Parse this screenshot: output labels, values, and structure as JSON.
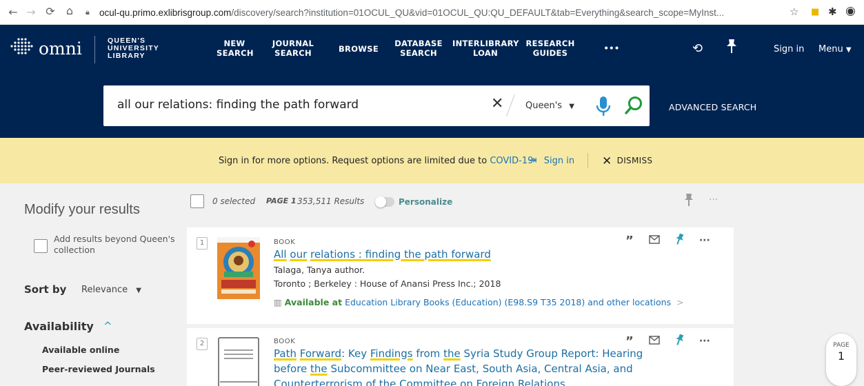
{
  "browser": {
    "url_host": "ocul-qu.primo.exlibrisgroup.com",
    "url_rest": "/discovery/search?institution=01OCUL_QU&vid=01OCUL_QU:QU_DEFAULT&tab=Everything&search_scope=MyInst..."
  },
  "header": {
    "logo_word": "omni",
    "logo_line1": "QUEEN'S",
    "logo_line2": "UNIVERSITY",
    "logo_line3": "LIBRARY",
    "nav": [
      {
        "l1": "NEW",
        "l2": "SEARCH"
      },
      {
        "l1": "JOURNAL",
        "l2": "SEARCH"
      },
      {
        "l1": "BROWSE",
        "l2": ""
      },
      {
        "l1": "DATABASE",
        "l2": "SEARCH"
      },
      {
        "l1": "INTERLIBRARY",
        "l2": "LOAN"
      },
      {
        "l1": "RESEARCH",
        "l2": "GUIDES"
      },
      {
        "l1": "•••",
        "l2": ""
      }
    ],
    "sign_in": "Sign in",
    "menu": "Menu"
  },
  "search": {
    "query": "all our relations: finding the path forward",
    "scope": "Queen's",
    "advanced": "ADVANCED SEARCH"
  },
  "banner": {
    "text": "Sign in for more options. Request options are limited due to",
    "link": "COVID-19",
    "sign_in": "Sign in",
    "dismiss": "DISMISS"
  },
  "facets": {
    "title": "Modify your results",
    "add_beyond_1": "Add results beyond Queen's",
    "add_beyond_2": "collection",
    "sort_label": "Sort by",
    "sort_value": "Relevance",
    "availability": "Availability",
    "items": [
      "Available online",
      "Peer-reviewed Journals"
    ]
  },
  "results_header": {
    "selected": "0 selected",
    "page": "PAGE 1",
    "count": "353,511 Results",
    "personalize": "Personalize"
  },
  "results": [
    {
      "num": "1",
      "type": "BOOK",
      "author": "Talaga, Tanya author.",
      "publisher": "Toronto ; Berkeley : House of Anansi Press Inc.; 2018",
      "avail_prefix": "Available at",
      "avail_loc": "Education Library  Books (Education) (E98.S9 T35 2018)",
      "avail_suffix": "and other locations"
    },
    {
      "num": "2",
      "type": "BOOK"
    }
  ],
  "page_indicator": {
    "label": "PAGE",
    "num": "1"
  },
  "colors": {
    "navy": "#002452",
    "banner": "#f7e9a4",
    "link": "#1c6fa3",
    "teal": "#2a9fb5",
    "highlight": "#f2d000"
  }
}
